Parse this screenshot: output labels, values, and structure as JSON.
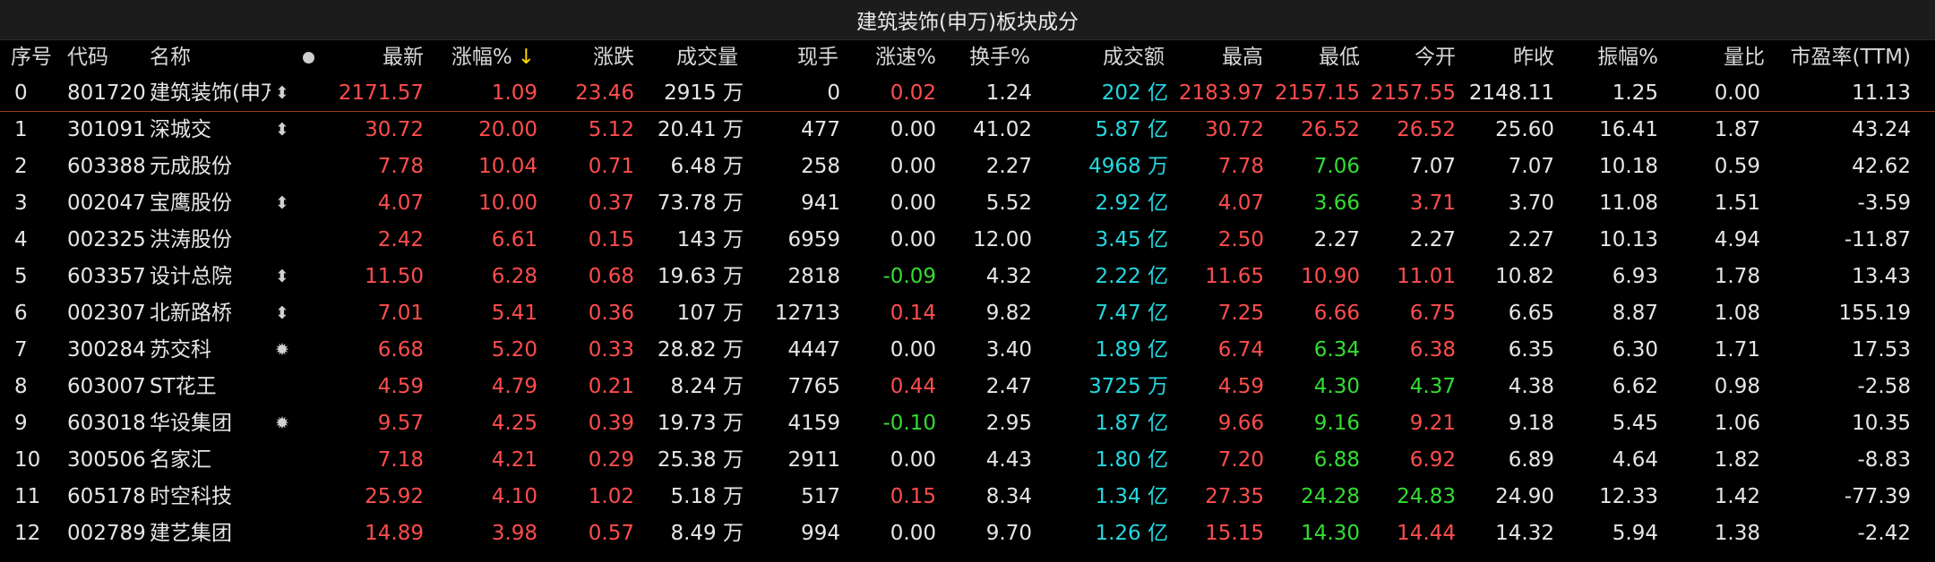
{
  "title": "建筑装饰(申万)板块成分",
  "columns": {
    "seq": "序号",
    "code": "代码",
    "name": "名称",
    "latest": "最新",
    "change_pct": "涨幅%",
    "sort_indicator": "↓",
    "change": "涨跌",
    "volume": "成交量",
    "current_hand": "现手",
    "speed_pct": "涨速%",
    "turnover_pct": "换手%",
    "amount": "成交额",
    "high": "最高",
    "low": "最低",
    "open": "今开",
    "prev_close": "昨收",
    "amplitude_pct": "振幅%",
    "volume_ratio": "量比",
    "pe_ttm": "市盈率(TTM)"
  },
  "colors": {
    "up": "#ff4d4d",
    "down": "#33dd33",
    "neutral": "#e6e6e6",
    "amount": "#25d8e0",
    "sort_arrow": "#ffd800",
    "background": "#000000"
  },
  "rows": [
    {
      "seq": "0",
      "code": "801720",
      "name": "建筑装饰(申万",
      "icon": "updown-arrow-icon",
      "latest": "2171.57",
      "change_pct": "1.09",
      "change": "23.46",
      "volume": "2915 万",
      "current_hand": "0",
      "speed_pct": "0.02",
      "turnover_pct": "1.24",
      "amount": "202 亿",
      "high": "2183.97",
      "low": "2157.15",
      "open": "2157.55",
      "prev_close": "2148.11",
      "amplitude_pct": "1.25",
      "volume_ratio": "0.00",
      "pe_ttm": "11.13",
      "c": {
        "latest": "red",
        "change_pct": "red",
        "change": "red",
        "speed_pct": "red",
        "high": "red",
        "low": "red",
        "open": "red"
      }
    },
    {
      "seq": "1",
      "code": "301091",
      "name": "深城交",
      "icon": "updown-arrow-icon",
      "latest": "30.72",
      "change_pct": "20.00",
      "change": "5.12",
      "volume": "20.41 万",
      "current_hand": "477",
      "speed_pct": "0.00",
      "turnover_pct": "41.02",
      "amount": "5.87 亿",
      "high": "30.72",
      "low": "26.52",
      "open": "26.52",
      "prev_close": "25.60",
      "amplitude_pct": "16.41",
      "volume_ratio": "1.87",
      "pe_ttm": "43.24",
      "c": {
        "latest": "red",
        "change_pct": "red",
        "change": "red",
        "speed_pct": "white",
        "high": "red",
        "low": "red",
        "open": "red"
      }
    },
    {
      "seq": "2",
      "code": "603388",
      "name": "元成股份",
      "icon": "",
      "latest": "7.78",
      "change_pct": "10.04",
      "change": "0.71",
      "volume": "6.48 万",
      "current_hand": "258",
      "speed_pct": "0.00",
      "turnover_pct": "2.27",
      "amount": "4968 万",
      "high": "7.78",
      "low": "7.06",
      "open": "7.07",
      "prev_close": "7.07",
      "amplitude_pct": "10.18",
      "volume_ratio": "0.59",
      "pe_ttm": "42.62",
      "c": {
        "latest": "red",
        "change_pct": "red",
        "change": "red",
        "speed_pct": "white",
        "high": "red",
        "low": "green",
        "open": "white"
      }
    },
    {
      "seq": "3",
      "code": "002047",
      "name": "宝鹰股份",
      "icon": "updown-arrow-icon",
      "latest": "4.07",
      "change_pct": "10.00",
      "change": "0.37",
      "volume": "73.78 万",
      "current_hand": "941",
      "speed_pct": "0.00",
      "turnover_pct": "5.52",
      "amount": "2.92 亿",
      "high": "4.07",
      "low": "3.66",
      "open": "3.71",
      "prev_close": "3.70",
      "amplitude_pct": "11.08",
      "volume_ratio": "1.51",
      "pe_ttm": "-3.59",
      "c": {
        "latest": "red",
        "change_pct": "red",
        "change": "red",
        "speed_pct": "white",
        "high": "red",
        "low": "green",
        "open": "red"
      }
    },
    {
      "seq": "4",
      "code": "002325",
      "name": "洪涛股份",
      "icon": "",
      "latest": "2.42",
      "change_pct": "6.61",
      "change": "0.15",
      "volume": "143 万",
      "current_hand": "6959",
      "speed_pct": "0.00",
      "turnover_pct": "12.00",
      "amount": "3.45 亿",
      "high": "2.50",
      "low": "2.27",
      "open": "2.27",
      "prev_close": "2.27",
      "amplitude_pct": "10.13",
      "volume_ratio": "4.94",
      "pe_ttm": "-11.87",
      "c": {
        "latest": "red",
        "change_pct": "red",
        "change": "red",
        "speed_pct": "white",
        "high": "red",
        "low": "white",
        "open": "white"
      }
    },
    {
      "seq": "5",
      "code": "603357",
      "name": "设计总院",
      "icon": "updown-arrow-icon",
      "latest": "11.50",
      "change_pct": "6.28",
      "change": "0.68",
      "volume": "19.63 万",
      "current_hand": "2818",
      "speed_pct": "-0.09",
      "turnover_pct": "4.32",
      "amount": "2.22 亿",
      "high": "11.65",
      "low": "10.90",
      "open": "11.01",
      "prev_close": "10.82",
      "amplitude_pct": "6.93",
      "volume_ratio": "1.78",
      "pe_ttm": "13.43",
      "c": {
        "latest": "red",
        "change_pct": "red",
        "change": "red",
        "speed_pct": "green",
        "high": "red",
        "low": "red",
        "open": "red"
      }
    },
    {
      "seq": "6",
      "code": "002307",
      "name": "北新路桥",
      "icon": "updown-arrow-icon",
      "latest": "7.01",
      "change_pct": "5.41",
      "change": "0.36",
      "volume": "107 万",
      "current_hand": "12713",
      "speed_pct": "0.14",
      "turnover_pct": "9.82",
      "amount": "7.47 亿",
      "high": "7.25",
      "low": "6.66",
      "open": "6.75",
      "prev_close": "6.65",
      "amplitude_pct": "8.87",
      "volume_ratio": "1.08",
      "pe_ttm": "155.19",
      "c": {
        "latest": "red",
        "change_pct": "red",
        "change": "red",
        "speed_pct": "red",
        "high": "red",
        "low": "red",
        "open": "red"
      }
    },
    {
      "seq": "7",
      "code": "300284",
      "name": "苏交科",
      "icon": "sun-icon",
      "latest": "6.68",
      "change_pct": "5.20",
      "change": "0.33",
      "volume": "28.82 万",
      "current_hand": "4447",
      "speed_pct": "0.00",
      "turnover_pct": "3.40",
      "amount": "1.89 亿",
      "high": "6.74",
      "low": "6.34",
      "open": "6.38",
      "prev_close": "6.35",
      "amplitude_pct": "6.30",
      "volume_ratio": "1.71",
      "pe_ttm": "17.53",
      "c": {
        "latest": "red",
        "change_pct": "red",
        "change": "red",
        "speed_pct": "white",
        "high": "red",
        "low": "green",
        "open": "red"
      }
    },
    {
      "seq": "8",
      "code": "603007",
      "name": "ST花王",
      "icon": "",
      "latest": "4.59",
      "change_pct": "4.79",
      "change": "0.21",
      "volume": "8.24 万",
      "current_hand": "7765",
      "speed_pct": "0.44",
      "turnover_pct": "2.47",
      "amount": "3725 万",
      "high": "4.59",
      "low": "4.30",
      "open": "4.37",
      "prev_close": "4.38",
      "amplitude_pct": "6.62",
      "volume_ratio": "0.98",
      "pe_ttm": "-2.58",
      "c": {
        "latest": "red",
        "change_pct": "red",
        "change": "red",
        "speed_pct": "red",
        "high": "red",
        "low": "green",
        "open": "green"
      }
    },
    {
      "seq": "9",
      "code": "603018",
      "name": "华设集团",
      "icon": "sun-icon",
      "latest": "9.57",
      "change_pct": "4.25",
      "change": "0.39",
      "volume": "19.73 万",
      "current_hand": "4159",
      "speed_pct": "-0.10",
      "turnover_pct": "2.95",
      "amount": "1.87 亿",
      "high": "9.66",
      "low": "9.16",
      "open": "9.21",
      "prev_close": "9.18",
      "amplitude_pct": "5.45",
      "volume_ratio": "1.06",
      "pe_ttm": "10.35",
      "c": {
        "latest": "red",
        "change_pct": "red",
        "change": "red",
        "speed_pct": "green",
        "high": "red",
        "low": "green",
        "open": "red"
      }
    },
    {
      "seq": "10",
      "code": "300506",
      "name": "名家汇",
      "icon": "",
      "latest": "7.18",
      "change_pct": "4.21",
      "change": "0.29",
      "volume": "25.38 万",
      "current_hand": "2911",
      "speed_pct": "0.00",
      "turnover_pct": "4.43",
      "amount": "1.80 亿",
      "high": "7.20",
      "low": "6.88",
      "open": "6.92",
      "prev_close": "6.89",
      "amplitude_pct": "4.64",
      "volume_ratio": "1.82",
      "pe_ttm": "-8.83",
      "c": {
        "latest": "red",
        "change_pct": "red",
        "change": "red",
        "speed_pct": "white",
        "high": "red",
        "low": "green",
        "open": "red"
      }
    },
    {
      "seq": "11",
      "code": "605178",
      "name": "时空科技",
      "icon": "",
      "latest": "25.92",
      "change_pct": "4.10",
      "change": "1.02",
      "volume": "5.18 万",
      "current_hand": "517",
      "speed_pct": "0.15",
      "turnover_pct": "8.34",
      "amount": "1.34 亿",
      "high": "27.35",
      "low": "24.28",
      "open": "24.83",
      "prev_close": "24.90",
      "amplitude_pct": "12.33",
      "volume_ratio": "1.42",
      "pe_ttm": "-77.39",
      "c": {
        "latest": "red",
        "change_pct": "red",
        "change": "red",
        "speed_pct": "red",
        "high": "red",
        "low": "green",
        "open": "green"
      }
    },
    {
      "seq": "12",
      "code": "002789",
      "name": "建艺集团",
      "icon": "",
      "latest": "14.89",
      "change_pct": "3.98",
      "change": "0.57",
      "volume": "8.49 万",
      "current_hand": "994",
      "speed_pct": "0.00",
      "turnover_pct": "9.70",
      "amount": "1.26 亿",
      "high": "15.15",
      "low": "14.30",
      "open": "14.44",
      "prev_close": "14.32",
      "amplitude_pct": "5.94",
      "volume_ratio": "1.38",
      "pe_ttm": "-2.42",
      "c": {
        "latest": "red",
        "change_pct": "red",
        "change": "red",
        "speed_pct": "white",
        "high": "red",
        "low": "green",
        "open": "red"
      }
    }
  ]
}
